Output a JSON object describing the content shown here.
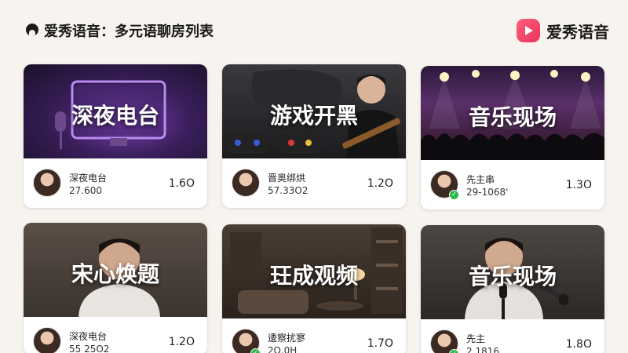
{
  "header": {
    "title": "爱秀语音：多元语聊房列表",
    "brand_name": "爱秀语音",
    "brand_color": "#e8335a"
  },
  "rooms": [
    {
      "cover_title": "深夜电台",
      "name": "深夜电台",
      "id": "27.600",
      "heat": "1.6O",
      "verified": false
    },
    {
      "cover_title": "游戏开黑",
      "name": "晋奥绑烘",
      "id": "57.33O2",
      "heat": "1.2O",
      "verified": false
    },
    {
      "cover_title": "音乐现场",
      "name": "先主串",
      "id": "29-1068'",
      "heat": "1.3O",
      "verified": true
    },
    {
      "cover_title": "宋心焕题",
      "name": "深夜电台",
      "id": "55 25O2",
      "heat": "1.2O",
      "verified": false
    },
    {
      "cover_title": "玨成观频",
      "name": "逶察扰寥",
      "id": "2Ω.0H",
      "heat": "1.7O",
      "verified": true
    },
    {
      "cover_title": "音乐现场",
      "name": "先主",
      "id": "2.1816",
      "heat": "1.8O",
      "verified": true
    }
  ]
}
